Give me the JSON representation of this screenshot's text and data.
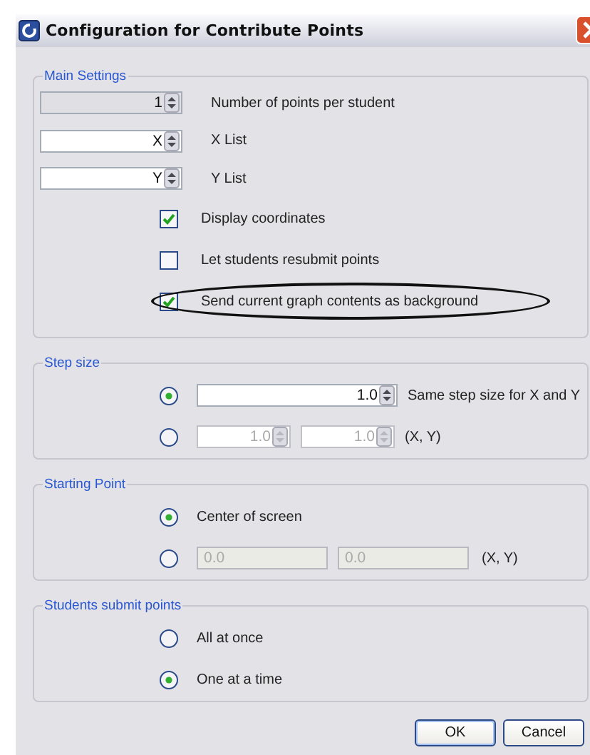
{
  "window": {
    "title": "Configuration for Contribute Points"
  },
  "main_settings": {
    "legend": "Main Settings",
    "spinners": [
      {
        "value": "1",
        "label": "Number of points per student",
        "readonly": true
      },
      {
        "value": "X",
        "label": "X List",
        "readonly": false
      },
      {
        "value": "Y",
        "label": "Y List",
        "readonly": false
      }
    ],
    "checkboxes": [
      {
        "label": "Display coordinates",
        "checked": true,
        "highlighted": false
      },
      {
        "label": "Let students resubmit points",
        "checked": false,
        "highlighted": false
      },
      {
        "label": "Send current graph contents as background",
        "checked": true,
        "highlighted": true
      }
    ]
  },
  "step_size": {
    "legend": "Step size",
    "options": [
      {
        "selected": true,
        "fields": [
          {
            "kind": "spinner",
            "value": "1.0",
            "disabled": false
          }
        ],
        "label": "Same step size for X and Y"
      },
      {
        "selected": false,
        "fields": [
          {
            "kind": "spinner",
            "value": "1.0",
            "disabled": true
          },
          {
            "kind": "spinner",
            "value": "1.0",
            "disabled": true
          }
        ],
        "label": "(X, Y)"
      }
    ]
  },
  "starting_point": {
    "legend": "Starting Point",
    "options": [
      {
        "selected": true,
        "label": "Center of screen"
      },
      {
        "selected": false,
        "fields": [
          {
            "kind": "text",
            "value": "0.0",
            "disabled": true
          },
          {
            "kind": "text",
            "value": "0.0",
            "disabled": true
          }
        ],
        "label": "(X, Y)"
      }
    ]
  },
  "submit_mode": {
    "legend": "Students submit points",
    "options": [
      {
        "selected": false,
        "label": "All at once"
      },
      {
        "selected": true,
        "label": "One at a time"
      }
    ]
  },
  "buttons": [
    {
      "label": "OK",
      "default": true
    },
    {
      "label": "Cancel",
      "default": false
    }
  ]
}
